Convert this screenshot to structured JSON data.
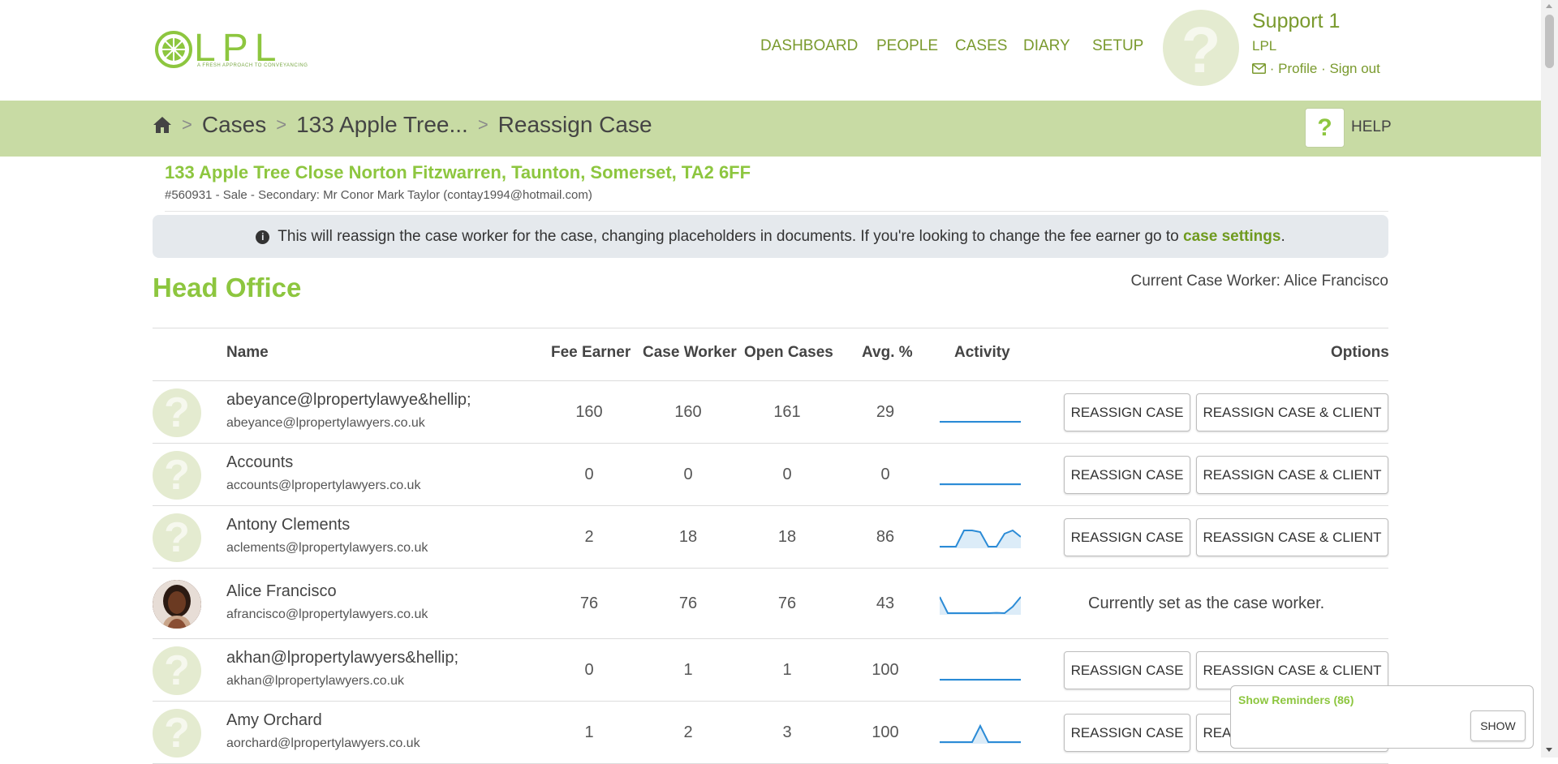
{
  "brand": {
    "logo_text": "LPL",
    "tagline": "A FRESH APPROACH TO CONVEYANCING",
    "accent": "#8dc63f",
    "header_bar": "#c8dba4"
  },
  "nav": [
    "DASHBOARD",
    "PEOPLE",
    "CASES",
    "DIARY",
    "SETUP"
  ],
  "user": {
    "avatar_glyph": "?",
    "name": "Support 1",
    "org": "LPL",
    "mail_icon": "envelope-icon",
    "profile": "Profile",
    "signout": "Sign out",
    "separator": "·"
  },
  "breadcrumb": {
    "home_icon": "home-icon",
    "items": [
      "Cases",
      "133 Apple Tree...",
      "Reassign Case"
    ],
    "separator": ">"
  },
  "help": {
    "glyph": "?",
    "label": "HELP"
  },
  "case": {
    "address": "133 Apple Tree Close Norton Fitzwarren, Taunton, Somerset, TA2 6FF",
    "subtitle": "#560931 - Sale - Secondary: Mr Conor Mark Taylor (contay1994@hotmail.com)"
  },
  "info": {
    "icon": "info-icon",
    "text": "This will reassign the case worker for the case, changing placeholders in documents. If you're looking to change the fee earner go to ",
    "link": "case settings",
    "end": "."
  },
  "office": {
    "title": "Head Office",
    "current_worker": "Current Case Worker: Alice Francisco"
  },
  "table": {
    "headers": {
      "name": "Name",
      "fee_earner": "Fee Earner",
      "case_worker": "Case Worker",
      "open_cases": "Open Cases",
      "avg": "Avg. %",
      "activity": "Activity",
      "options": "Options"
    },
    "buttons": {
      "reassign": "REASSIGN CASE",
      "reassign_client": "REASSIGN CASE & CLIENT"
    },
    "current_note": "Currently set as the case worker.",
    "rows": [
      {
        "name": "abeyance@lpropertylawye&hellip;",
        "email": "abeyance@lpropertylawyers.co.uk",
        "fee_earner": "160",
        "case_worker": "160",
        "open_cases": "161",
        "avg": "29",
        "avatar": "?",
        "activity": [
          0,
          0,
          0,
          0,
          0,
          0,
          0,
          0,
          0,
          0,
          0
        ]
      },
      {
        "name": "Accounts",
        "email": "accounts@lpropertylawyers.co.uk",
        "fee_earner": "0",
        "case_worker": "0",
        "open_cases": "0",
        "avg": "0",
        "avatar": "?",
        "activity": [
          0,
          0,
          0,
          0,
          0,
          0,
          0,
          0,
          0,
          0,
          0
        ]
      },
      {
        "name": "Antony Clements",
        "email": "aclements@lpropertylawyers.co.uk",
        "fee_earner": "2",
        "case_worker": "18",
        "open_cases": "18",
        "avg": "86",
        "avatar": "?",
        "activity": [
          0,
          0,
          0,
          1,
          1,
          0.9,
          0,
          0,
          0.8,
          1,
          0.6
        ]
      },
      {
        "name": "Alice Francisco",
        "email": "afrancisco@lpropertylawyers.co.uk",
        "fee_earner": "76",
        "case_worker": "76",
        "open_cases": "76",
        "avg": "43",
        "avatar": "photo",
        "current": true,
        "activity": [
          1,
          0,
          0,
          0,
          0,
          0,
          0,
          0.02,
          0,
          0.4,
          1
        ]
      },
      {
        "name": "akhan@lpropertylawyers&hellip;",
        "email": "akhan@lpropertylawyers.co.uk",
        "fee_earner": "0",
        "case_worker": "1",
        "open_cases": "1",
        "avg": "100",
        "avatar": "?",
        "activity": [
          0,
          0,
          0,
          0,
          0,
          0,
          0,
          0,
          0,
          0,
          0
        ]
      },
      {
        "name": "Amy Orchard",
        "email": "aorchard@lpropertylawyers.co.uk",
        "fee_earner": "1",
        "case_worker": "2",
        "open_cases": "3",
        "avg": "100",
        "avatar": "?",
        "activity": [
          0,
          0,
          0,
          0,
          0,
          1,
          0,
          0,
          0,
          0,
          0
        ]
      }
    ]
  },
  "reminders": {
    "title": "Show Reminders (86)",
    "button": "SHOW"
  },
  "spark_color": "#2b8bd6"
}
